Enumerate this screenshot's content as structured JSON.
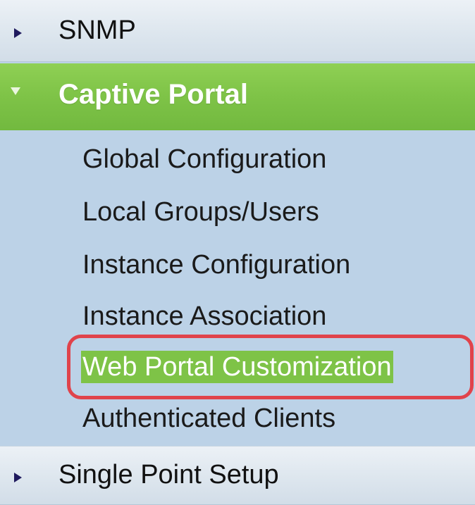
{
  "nav": {
    "snmp": {
      "label": "SNMP",
      "icon": "caret-right-icon"
    },
    "captive_portal": {
      "label": "Captive Portal",
      "icon": "caret-down-icon",
      "items": [
        {
          "label": "Global Configuration"
        },
        {
          "label": "Local Groups/Users"
        },
        {
          "label": "Instance Configuration"
        },
        {
          "label": "Instance Association"
        },
        {
          "label": "Web Portal Customization",
          "selected": true
        },
        {
          "label": "Authenticated Clients"
        }
      ]
    },
    "single_point_setup": {
      "label": "Single Point Setup",
      "icon": "caret-right-icon"
    }
  },
  "colors": {
    "accent_green": "#7ec347",
    "nav_background": "#bcd2e7",
    "highlight_ring": "#e0434b",
    "arrow": "#1f1a5e"
  }
}
